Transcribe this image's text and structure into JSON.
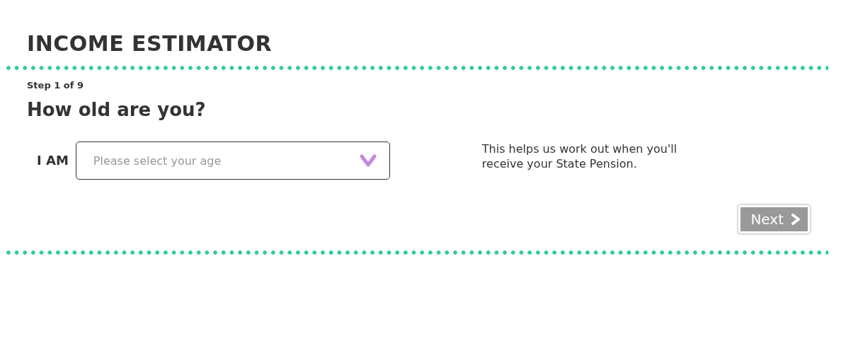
{
  "title": "INCOME ESTIMATOR",
  "step": "Step 1 of 9",
  "question": "How old are you?",
  "age_field": {
    "label": "I AM",
    "placeholder": "Please select your age"
  },
  "help_text": "This helps us work out when you'll receive your State Pension.",
  "next_button": {
    "label": "Next",
    "disabled": true
  }
}
